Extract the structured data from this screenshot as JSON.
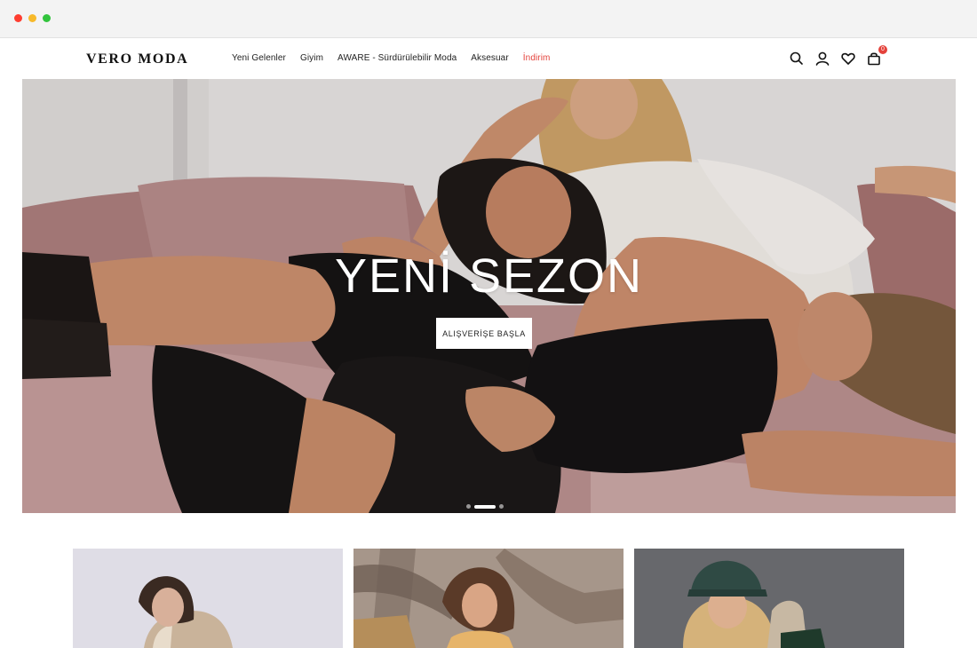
{
  "browser": {
    "window_controls": [
      "close",
      "minimize",
      "maximize"
    ]
  },
  "header": {
    "logo": "VERO MODA",
    "nav": [
      {
        "label": "Yeni Gelenler"
      },
      {
        "label": "Giyim"
      },
      {
        "label": "AWARE - Sürdürülebilir Moda"
      },
      {
        "label": "Aksesuar"
      },
      {
        "label": "İndirim"
      }
    ],
    "icons": [
      "search-icon",
      "account-icon",
      "wishlist-icon",
      "cart-icon"
    ],
    "cart_count": "0"
  },
  "hero": {
    "title": "YENİ SEZON",
    "cta": "ALIŞVERİŞE BAŞLA",
    "slides": 3,
    "active_slide": 2
  },
  "colors": {
    "sale": "#e4423b",
    "text": "#222222",
    "hero_sofa": "#b88a87"
  }
}
